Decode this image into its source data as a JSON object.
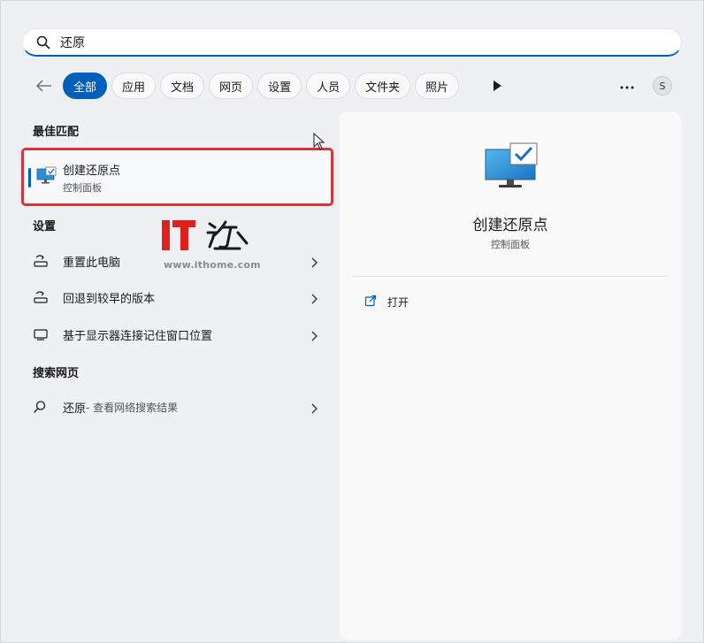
{
  "search": {
    "query": "还原"
  },
  "filters": {
    "chips": [
      "全部",
      "应用",
      "文档",
      "网页",
      "设置",
      "人员",
      "文件夹",
      "照片"
    ],
    "active_index": 0,
    "avatar_letter": "S"
  },
  "best_match": {
    "section_title": "最佳匹配",
    "name": "创建还原点",
    "sub": "控制面板"
  },
  "settings": {
    "section_title": "设置",
    "items": [
      {
        "label": "重置此电脑",
        "icon": "reset-pc-icon"
      },
      {
        "label": "回退到较早的版本",
        "icon": "reset-pc-icon"
      },
      {
        "label": "基于显示器连接记住窗口位置",
        "icon": "monitor-icon"
      }
    ]
  },
  "web": {
    "section_title": "搜索网页",
    "query": "还原",
    "sub": " - 查看网络搜索结果"
  },
  "watermark": {
    "url": "www.ithome.com"
  },
  "detail": {
    "title": "创建还原点",
    "sub": "控制面板",
    "action_open": "打开"
  },
  "colors": {
    "accent": "#005fb8",
    "highlight": "#d4353a",
    "watermark_red": "#e0201c"
  }
}
